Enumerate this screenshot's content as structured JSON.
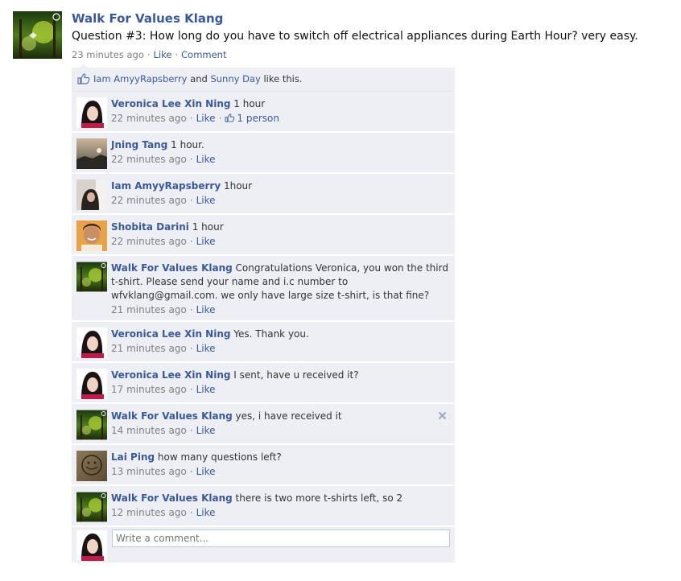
{
  "post": {
    "author": "Walk For Values Klang",
    "text": "Question #3: How long do you have to switch off electrical appliances during Earth Hour? very easy.",
    "time": "23 minutes ago",
    "like_label": "Like",
    "comment_label": "Comment",
    "avatar_icon": "nature-forest-avatar"
  },
  "likes": {
    "user1": "Iam AmyyRapsberry",
    "and": "and",
    "user2": "Sunny Day",
    "suffix": "like this.",
    "icon": "thumbs-up-icon"
  },
  "comments": [
    {
      "author": "Veronica Lee Xin Ning",
      "text": "1 hour",
      "time": "22 minutes ago",
      "like": "Like",
      "likes_count": "1 person",
      "avatar": "girl-avatar"
    },
    {
      "author": "Jning Tang",
      "text": "1 hour.",
      "time": "22 minutes ago",
      "like": "Like",
      "avatar": "sunset-avatar"
    },
    {
      "author": "Iam AmyyRapsberry",
      "text": "1hour",
      "time": "22 minutes ago",
      "like": "Like",
      "avatar": "selfie-avatar"
    },
    {
      "author": "Shobita Darini",
      "text": "1 hour",
      "time": "22 minutes ago",
      "like": "Like",
      "avatar": "smiling-girl-avatar"
    },
    {
      "author": "Walk For Values Klang",
      "text": "Congratulations Veronica, you won the third t-shirt. Please send your name and i.c number to wfvklang@gmail.com. we only have large size t-shirt, is that fine?",
      "time": "21 minutes ago",
      "like": "Like",
      "avatar": "nature-forest-avatar"
    },
    {
      "author": "Veronica Lee Xin Ning",
      "text": "Yes. Thank you.",
      "time": "21 minutes ago",
      "like": "Like",
      "avatar": "girl-avatar"
    },
    {
      "author": "Veronica Lee Xin Ning",
      "text": "I sent, have u received it?",
      "time": "17 minutes ago",
      "like": "Like",
      "avatar": "girl-avatar"
    },
    {
      "author": "Walk For Values Klang",
      "text": "yes, i have received it",
      "time": "14 minutes ago",
      "like": "Like",
      "avatar": "nature-forest-avatar",
      "close_icon": "close-icon"
    },
    {
      "author": "Lai Ping",
      "text": "how many questions left?",
      "time": "13 minutes ago",
      "like": "Like",
      "avatar": "sketch-avatar"
    },
    {
      "author": "Walk For Values Klang",
      "text": "there is two more t-shirts left, so 2",
      "time": "12 minutes ago",
      "like": "Like",
      "avatar": "nature-forest-avatar"
    }
  ],
  "composer": {
    "placeholder": "Write a comment..."
  },
  "colors": {
    "link": "#3b5998",
    "ufi_background": "#edeff4",
    "meta_text": "#808080"
  }
}
